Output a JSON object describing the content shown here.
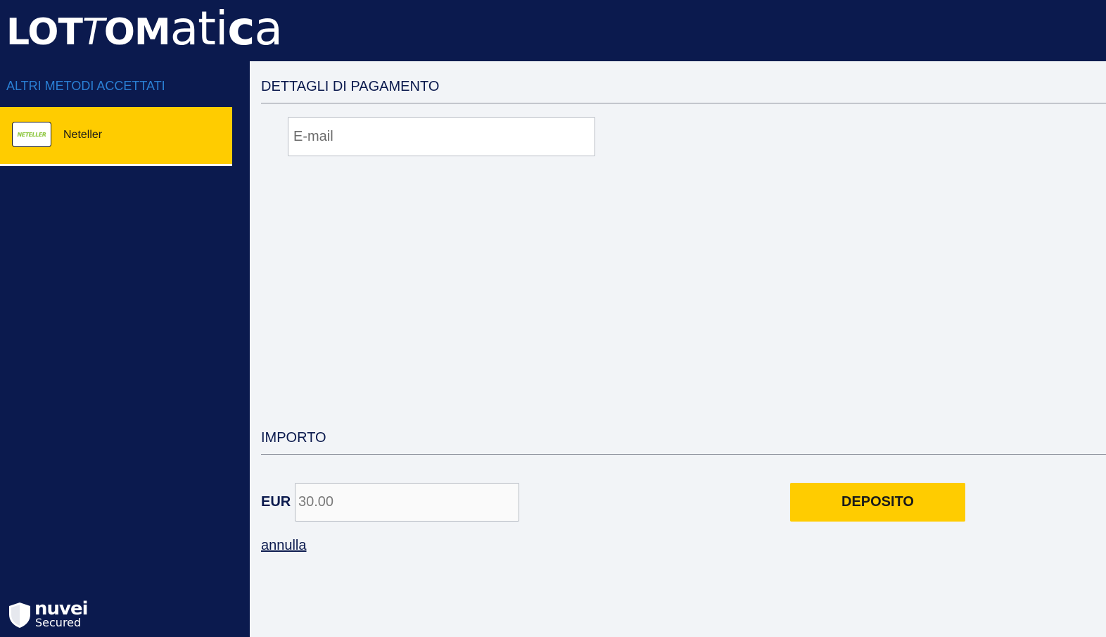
{
  "header": {
    "logo_caps_1": "LOT",
    "logo_caps_italic": "T",
    "logo_caps_2": "OM",
    "logo_lower_1": "ati",
    "logo_lower_bold": "c",
    "logo_lower_2": "a"
  },
  "sidebar": {
    "title": "ALTRI METODI ACCETTATI",
    "methods": [
      {
        "label": "Neteller",
        "logo_text": "NETELLER",
        "selected": true
      }
    ],
    "footer": {
      "brand": "nuvei",
      "sub": "Secured",
      "icon": "shield-icon"
    }
  },
  "payment_details": {
    "title": "DETTAGLI DI PAGAMENTO",
    "email": {
      "value": "",
      "placeholder": "E-mail"
    }
  },
  "amount": {
    "title": "IMPORTO",
    "currency": "EUR",
    "input": {
      "value": "",
      "placeholder": "30.00"
    },
    "deposit_label": "DEPOSITO",
    "cancel_label": "annulla"
  },
  "colors": {
    "navy": "#0b1a4e",
    "accent_yellow": "#ffcc00",
    "link_blue": "#2a7fd4",
    "neteller_green": "#8dc63f"
  }
}
